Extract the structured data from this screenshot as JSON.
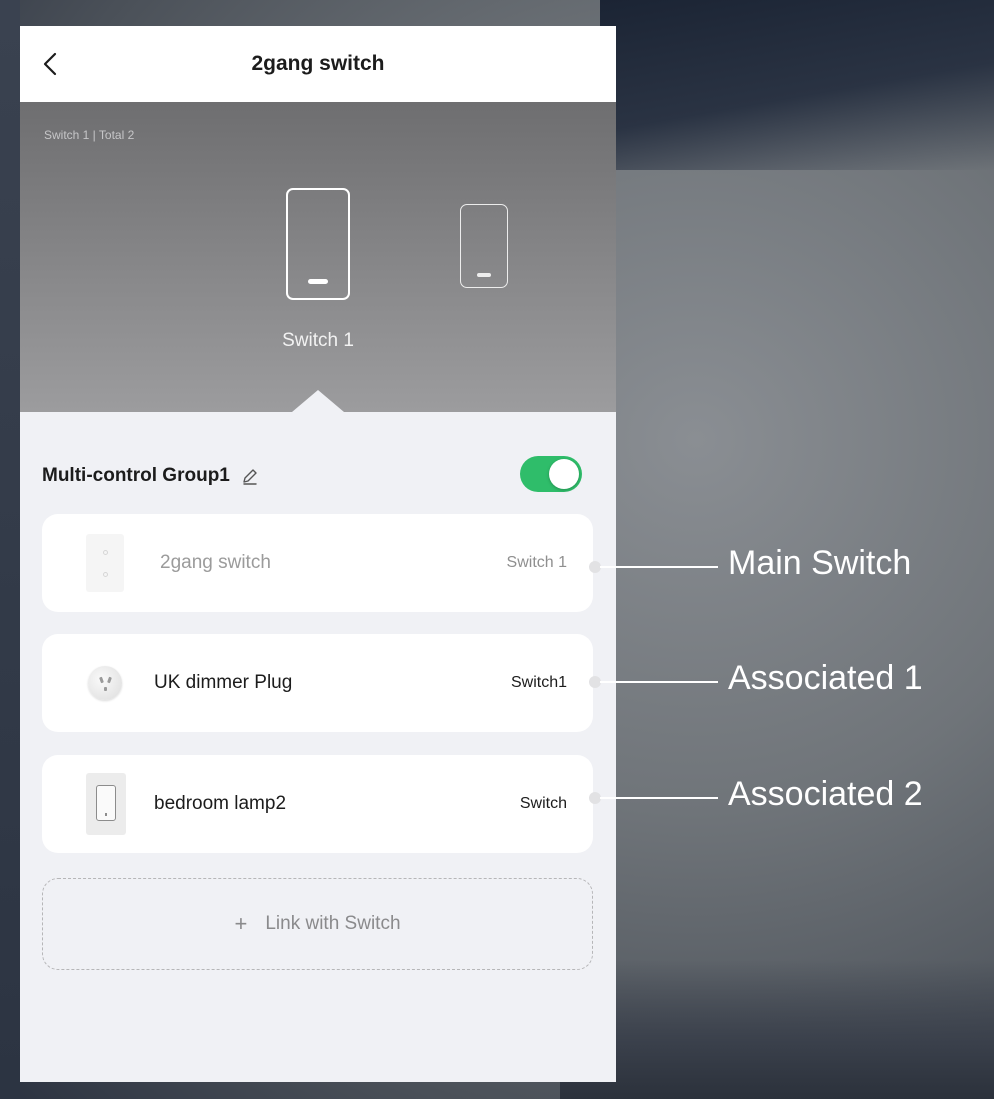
{
  "header": {
    "title": "2gang switch",
    "back_icon": "chevron-left-icon"
  },
  "hero": {
    "caption": "Switch 1 | Total 2",
    "selected_switch_label": "Switch 1"
  },
  "group": {
    "title": "Multi-control Group1",
    "edit_icon": "pencil-icon",
    "enabled": true,
    "toggle_color": "#2fbd6a"
  },
  "devices": [
    {
      "name": "2gang switch",
      "channel": "Switch 1",
      "icon": "two-gang-switch-icon"
    },
    {
      "name": "UK dimmer Plug",
      "channel": "Switch1",
      "icon": "uk-plug-icon"
    },
    {
      "name": "bedroom lamp2",
      "channel": "Switch",
      "icon": "single-switch-icon"
    }
  ],
  "link_button": {
    "plus": "+",
    "label": "Link with Switch"
  },
  "annotations": [
    {
      "label": "Main Switch"
    },
    {
      "label": "Associated 1"
    },
    {
      "label": "Associated 2"
    }
  ]
}
